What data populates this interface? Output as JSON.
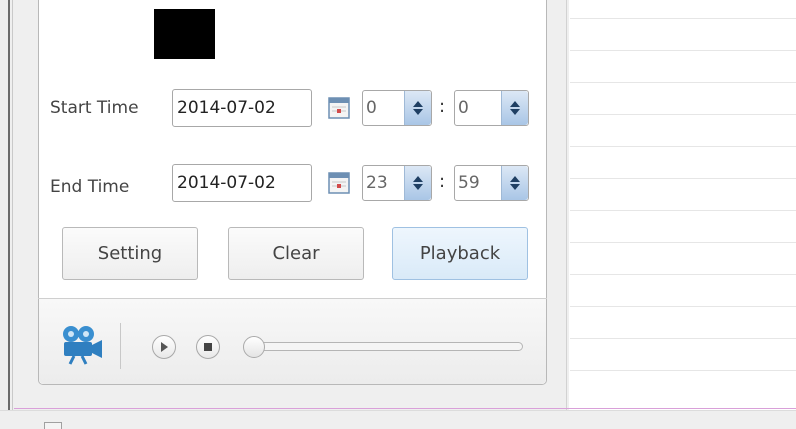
{
  "start_time": {
    "label": "Start Time",
    "date": "2014-07-02",
    "hour": "0",
    "minute": "0"
  },
  "end_time": {
    "label": "End Time",
    "date": "2014-07-02",
    "hour": "23",
    "minute": "59"
  },
  "time_separator": ":",
  "buttons": {
    "setting": "Setting",
    "clear": "Clear",
    "playback": "Playback"
  },
  "toolbar": {
    "playback_progress": 0,
    "icons": [
      "video-camera-icon",
      "play-icon",
      "stop-icon"
    ]
  },
  "colors": {
    "spinner_accent": "#a9c6e6",
    "playback_button": "#d9eaf8",
    "camera_icon": "#3a8fd0",
    "preview_box": "#000000"
  }
}
